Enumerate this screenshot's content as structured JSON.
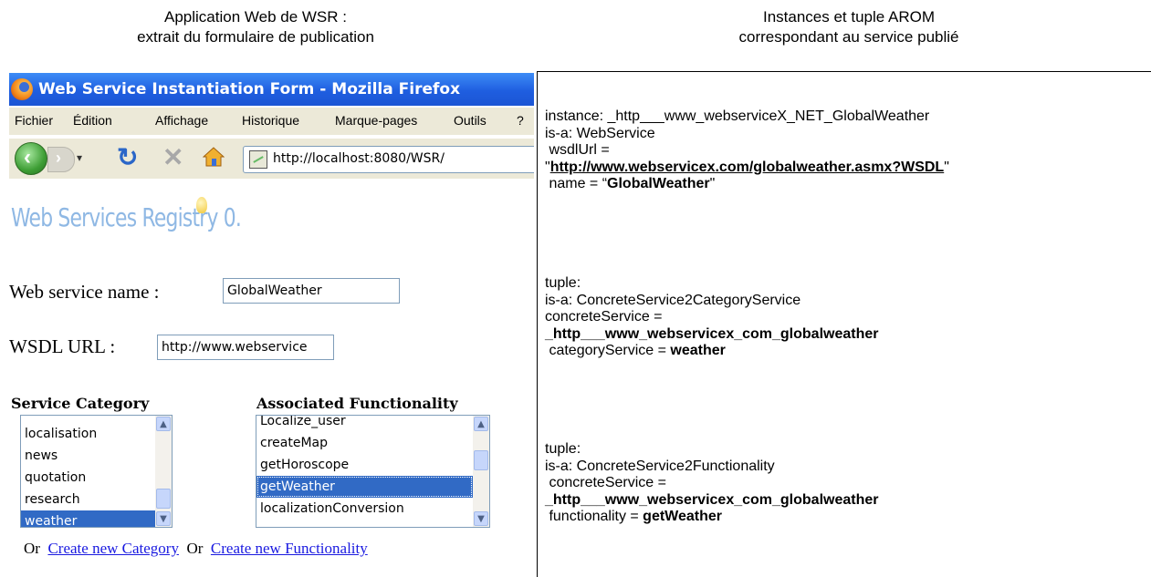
{
  "captions": {
    "left_line1": "Application Web de WSR :",
    "left_line2": "extrait du formulaire de publication",
    "right_line1": "Instances et tuple AROM",
    "right_line2": "correspondant au service publié"
  },
  "browser": {
    "window_title": "Web Service Instantiation Form - Mozilla Firefox",
    "menu": [
      "Fichier",
      "Édition",
      "Affichage",
      "Historique",
      "Marque-pages",
      "Outils",
      "?"
    ],
    "url": "http://localhost:8080/WSR/"
  },
  "form": {
    "logo_text": "Web Services Registry 0.",
    "ws_name_label": "Web service name :",
    "ws_name_value": "GlobalWeather",
    "wsdl_label": "WSDL URL :",
    "wsdl_value": "http://www.webservice",
    "category_label": "Service Category",
    "functionality_label": "Associated Functionality",
    "categories": [
      "localisation",
      "news",
      "quotation",
      "research",
      "weather"
    ],
    "selected_category": "weather",
    "functionalities": [
      "Localize_user",
      "createMap",
      "getHoroscope",
      "getWeather",
      "localizationConversion"
    ],
    "selected_functionality": "getWeather",
    "or_text": "Or",
    "create_category_link": "Create new Category",
    "create_functionality_link": "Create new Functionality"
  },
  "arom": {
    "block1": {
      "l1": "instance: _http___www_webserviceX_NET_GlobalWeather",
      "l2": "is-a: WebService",
      "l3": " wsdlUrl =",
      "l4_quote_open": "\"",
      "l4_url": "http://www.webservicex.com/globalweather.asmx?WSDL",
      "l4_quote_close": "\"",
      "l5_prefix": " name = “",
      "l5_value": "GlobalWeather",
      "l5_suffix": "\""
    },
    "block2": {
      "l1": "tuple:",
      "l2": "is-a: ConcreteService2CategoryService",
      "l3": "concreteService =",
      "l4": "_http___www_webservicex_com_globalweather",
      "l5_prefix": " categoryService = ",
      "l5_value": "weather"
    },
    "block3": {
      "l1": "tuple:",
      "l2": "is-a: ConcreteService2Functionality",
      "l3": " concreteService =",
      "l4": "_http___www_webservicex_com_globalweather",
      "l5_prefix": " functionality = ",
      "l5_value": "getWeather"
    }
  }
}
